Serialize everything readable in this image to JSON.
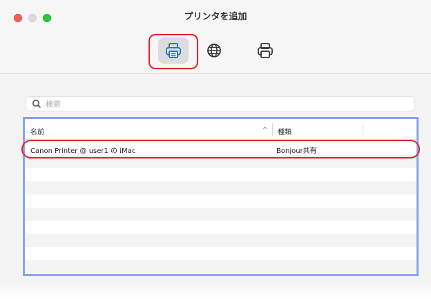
{
  "window": {
    "title": "プリンタを追加"
  },
  "toolbar": {
    "items": [
      {
        "icon": "printer-icon",
        "selected": true
      },
      {
        "icon": "globe-icon",
        "selected": false
      },
      {
        "icon": "printer-fax-icon",
        "selected": false
      }
    ]
  },
  "search": {
    "placeholder": "検索"
  },
  "table": {
    "columns": [
      "名前",
      "種類"
    ],
    "sort_indicator": "^",
    "rows": [
      {
        "name": "Canon Printer @ user1 の iMac",
        "kind": "Bonjour共有"
      }
    ]
  },
  "colors": {
    "highlight": "#e0202a",
    "list_border": "#8aa2ec",
    "close": "#ff5f57",
    "maximize": "#28c840"
  }
}
